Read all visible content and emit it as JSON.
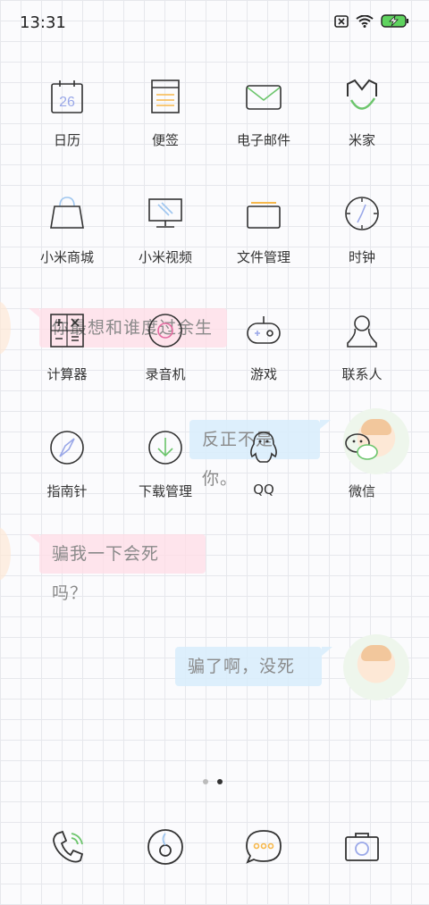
{
  "status_bar": {
    "time": "13:31",
    "icons": [
      "sim-off-icon",
      "wifi-icon",
      "battery-charging-icon"
    ]
  },
  "wallpaper": {
    "bubbles": [
      "你最想和谁度过余生",
      "反正不是你。",
      "骗我一下会死吗？",
      "骗了啊，没死"
    ]
  },
  "apps": [
    {
      "label": "日历",
      "icon": "calendar-icon",
      "day": "26"
    },
    {
      "label": "便签",
      "icon": "notes-icon"
    },
    {
      "label": "电子邮件",
      "icon": "mail-icon"
    },
    {
      "label": "米家",
      "icon": "mijia-icon"
    },
    {
      "label": "小米商城",
      "icon": "shopping-bag-icon"
    },
    {
      "label": "小米视频",
      "icon": "video-monitor-icon"
    },
    {
      "label": "文件管理",
      "icon": "folder-icon"
    },
    {
      "label": "时钟",
      "icon": "clock-icon"
    },
    {
      "label": "计算器",
      "icon": "calculator-icon"
    },
    {
      "label": "录音机",
      "icon": "recorder-icon"
    },
    {
      "label": "游戏",
      "icon": "gamepad-icon"
    },
    {
      "label": "联系人",
      "icon": "contacts-icon"
    },
    {
      "label": "指南针",
      "icon": "compass-icon"
    },
    {
      "label": "下载管理",
      "icon": "download-icon"
    },
    {
      "label": "QQ",
      "icon": "qq-penguin-icon"
    },
    {
      "label": "微信",
      "icon": "wechat-icon"
    }
  ],
  "page_indicator": {
    "count": 2,
    "active": 2
  },
  "dock": [
    "phone-icon",
    "browser-icon",
    "messages-icon",
    "camera-icon"
  ],
  "colors": {
    "accent_green": "#5fd35f",
    "accent_blue": "#9fc6ef",
    "accent_orange": "#f7b84b",
    "line": "#333333"
  }
}
